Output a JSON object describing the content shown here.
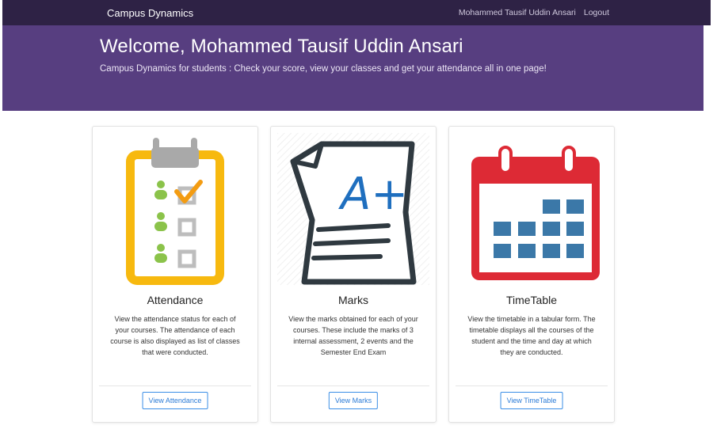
{
  "navbar": {
    "brand": "Campus Dynamics",
    "user_name": "Mohammed Tausif Uddin Ansari",
    "logout_label": "Logout"
  },
  "hero": {
    "title": "Welcome, Mohammed Tausif Uddin Ansari",
    "subtitle": "Campus Dynamics for students : Check your score, view your classes and get your attendance all in one page!"
  },
  "cards": [
    {
      "title": "Attendance",
      "text": "View the attendance status for each of your courses. The attendance of each course is also displayed as list of classes that were conducted.",
      "button": "View Attendance",
      "icon": "clipboard-checklist-icon"
    },
    {
      "title": "Marks",
      "text": "View the marks obtained for each of your courses. These include the marks of 3 internal assessment, 2 events and the Semester End Exam",
      "button": "View Marks",
      "icon": "grade-paper-icon",
      "icon_text": "A+"
    },
    {
      "title": "TimeTable",
      "text": "View the timetable in a tabular form. The timetable displays all the courses of the student and the time and day at which they are conducted.",
      "button": "View TimeTable",
      "icon": "calendar-icon"
    }
  ],
  "colors": {
    "navbar": "#2e2245",
    "hero": "#573e80",
    "button_border": "#3a8ee6",
    "clipboard_yellow": "#f7b90f",
    "calendar_red": "#dd2a35",
    "calendar_cells": "#3b78a8",
    "person_green": "#8bc34a"
  }
}
